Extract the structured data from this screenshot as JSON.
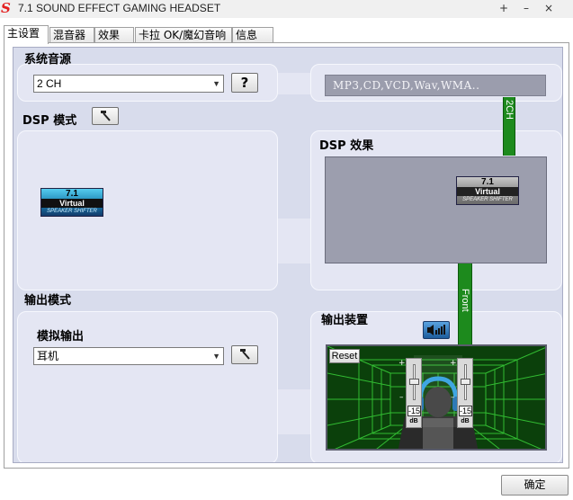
{
  "window": {
    "title": "7.1 SOUND EFFECT GAMING HEADSET",
    "logo_text": "S",
    "pin_icon": "+",
    "minimize_icon": "–",
    "close_icon": "×"
  },
  "tabs": [
    {
      "label": "主设置",
      "active": true
    },
    {
      "label": "混音器",
      "active": false
    },
    {
      "label": "效果",
      "active": false
    },
    {
      "label": "卡拉 OK/魔幻音响",
      "active": false
    },
    {
      "label": "信息",
      "active": false
    }
  ],
  "main": {
    "system_source": {
      "label": "系统音源",
      "selected": "2 CH",
      "help_label": "?"
    },
    "formats": "MP3,CD,VCD,Wav,WMA..",
    "channel_tag": "2CH",
    "dsp_mode": {
      "label": "DSP 模式"
    },
    "dsp_effect": {
      "label": "DSP 效果"
    },
    "front_tag": "Front",
    "output_mode": {
      "label": "输出模式",
      "sub_label": "模拟输出",
      "selected": "耳机"
    },
    "output_device": {
      "label": "输出装置",
      "reset_label": "Reset",
      "left_volume": "-15",
      "right_volume": "-15",
      "unit": "dB",
      "plus": "+",
      "minus": "–"
    }
  },
  "virtual_logo": {
    "line1": "7.1",
    "line2": "Virtual",
    "line3": "SPEAKER SHIFTER"
  },
  "footer": {
    "ok_label": "确定"
  },
  "colors": {
    "panel_bg": "#d8dcec",
    "box_bg": "#e4e6f3",
    "connector_green": "#1d8a1d",
    "effect_box": "#9c9eae",
    "scene_green": "#083808"
  }
}
